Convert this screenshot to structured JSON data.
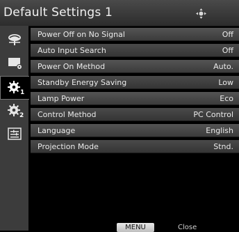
{
  "window": {
    "title": "Default Settings 1"
  },
  "icons": {
    "nav": "four-way-nav-icon",
    "sidebar": [
      "picture-settings-icon",
      "display-settings-icon",
      "default-settings-1-gear-icon",
      "default-settings-2-gear-icon",
      "info-settings-icon"
    ]
  },
  "sidebar": {
    "items": [
      {
        "name": "picture",
        "sub": ""
      },
      {
        "name": "display",
        "sub": ""
      },
      {
        "name": "default-settings-1",
        "sub": "1",
        "active": true
      },
      {
        "name": "default-settings-2",
        "sub": "2"
      },
      {
        "name": "info",
        "sub": ""
      }
    ]
  },
  "settings": [
    {
      "label": "Power Off on No Signal",
      "value": "Off"
    },
    {
      "label": "Auto Input Search",
      "value": "Off"
    },
    {
      "label": "Power On Method",
      "value": "Auto."
    },
    {
      "label": "Standby Energy Saving",
      "value": "Low"
    },
    {
      "label": "Lamp Power",
      "value": "Eco"
    },
    {
      "label": "Control Method",
      "value": "PC Control"
    },
    {
      "label": "Language",
      "value": "English"
    },
    {
      "label": "Projection Mode",
      "value": "Stnd."
    }
  ],
  "footer": {
    "menu_label": "MENU",
    "close_label": "Close"
  },
  "colors": {
    "title_bar": "#3a3a3a",
    "row": "#4a4a4a",
    "background": "#000000",
    "sidebar": "#3c3c3c"
  }
}
